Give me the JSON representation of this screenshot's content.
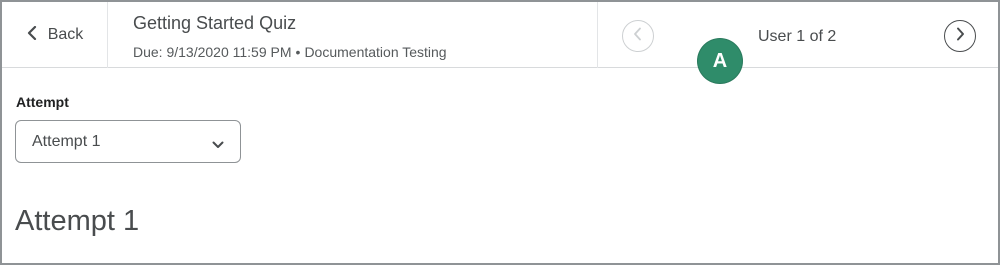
{
  "header": {
    "back_label": "Back",
    "title": "Getting Started Quiz",
    "due": "Due: 9/13/2020 11:59 PM",
    "separator": "•",
    "course": "Documentation Testing",
    "user_position": "User 1 of 2"
  },
  "badge": {
    "letter": "A",
    "color": "#2f8c6a"
  },
  "attempt": {
    "label": "Attempt",
    "selected": "Attempt 1",
    "heading": "Attempt 1"
  },
  "icons": {
    "back": "chevron-left-icon",
    "prev": "circle-chevron-left-icon",
    "next": "circle-chevron-right-icon",
    "dropdown": "chevron-down-icon"
  }
}
